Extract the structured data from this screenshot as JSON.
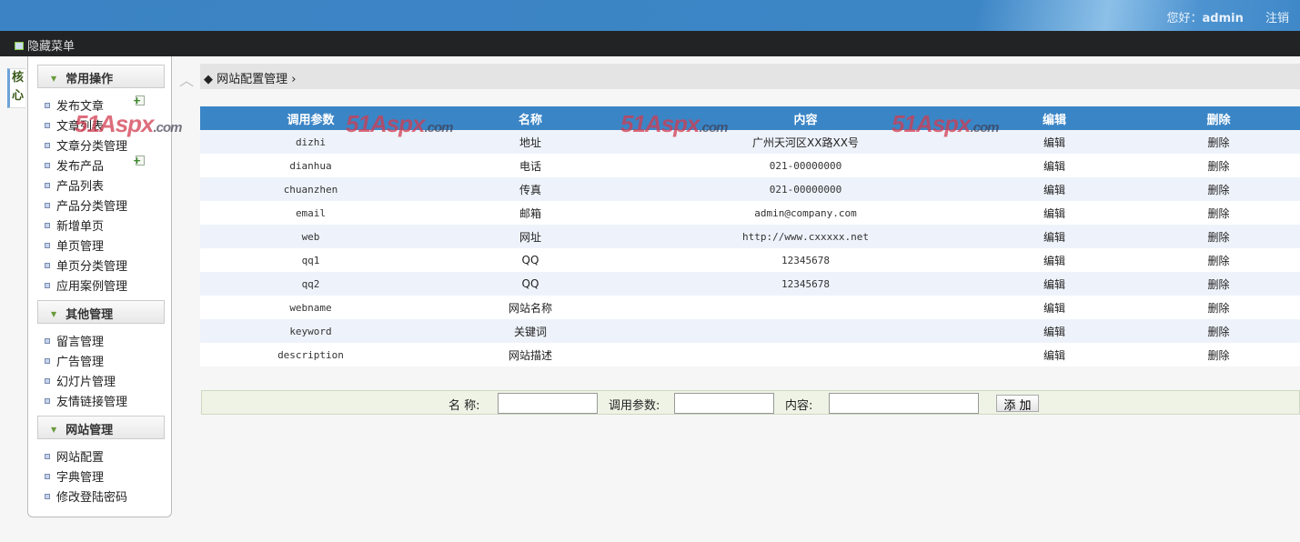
{
  "header": {
    "greeting": "您好：",
    "username": "admin",
    "logout": "注销"
  },
  "toolbar": {
    "toggle_menu": "隐藏菜单"
  },
  "core_tab": "核心",
  "sidebar": {
    "groups": [
      {
        "title": "常用操作",
        "items": [
          {
            "label": "发布文章",
            "add": true
          },
          {
            "label": "文章列表"
          },
          {
            "label": "文章分类管理"
          },
          {
            "label": "发布产品",
            "add": true
          },
          {
            "label": "产品列表"
          },
          {
            "label": "产品分类管理"
          },
          {
            "label": "新增单页"
          },
          {
            "label": "单页管理"
          },
          {
            "label": "单页分类管理"
          },
          {
            "label": "应用案例管理"
          }
        ]
      },
      {
        "title": "其他管理",
        "items": [
          {
            "label": "留言管理"
          },
          {
            "label": "广告管理"
          },
          {
            "label": "幻灯片管理"
          },
          {
            "label": "友情链接管理"
          }
        ]
      },
      {
        "title": "网站管理",
        "items": [
          {
            "label": "网站配置"
          },
          {
            "label": "字典管理"
          },
          {
            "label": "修改登陆密码"
          }
        ]
      }
    ]
  },
  "breadcrumb": {
    "title": "网站配置管理"
  },
  "watermark": "51Aspx.com",
  "table": {
    "headers": [
      "调用参数",
      "名称",
      "内容",
      "编辑",
      "删除"
    ],
    "rows": [
      [
        "dizhi",
        "地址",
        "广州天河区XX路XX号",
        "编辑",
        "删除"
      ],
      [
        "dianhua",
        "电话",
        "021-00000000",
        "编辑",
        "删除"
      ],
      [
        "chuanzhen",
        "传真",
        "021-00000000",
        "编辑",
        "删除"
      ],
      [
        "email",
        "邮箱",
        "admin@company.com",
        "编辑",
        "删除"
      ],
      [
        "web",
        "网址",
        "http://www.cxxxxx.net",
        "编辑",
        "删除"
      ],
      [
        "qq1",
        "QQ",
        "12345678",
        "编辑",
        "删除"
      ],
      [
        "qq2",
        "QQ",
        "12345678",
        "编辑",
        "删除"
      ],
      [
        "webname",
        "网站名称",
        "",
        "编辑",
        "删除"
      ],
      [
        "keyword",
        "关键词",
        "",
        "编辑",
        "删除"
      ],
      [
        "description",
        "网站描述",
        "",
        "编辑",
        "删除"
      ]
    ]
  },
  "form": {
    "name_label": "名 称:",
    "param_label": "调用参数:",
    "content_label": "内容:",
    "name_value": "",
    "param_value": "",
    "content_value": "",
    "submit": "添 加"
  }
}
